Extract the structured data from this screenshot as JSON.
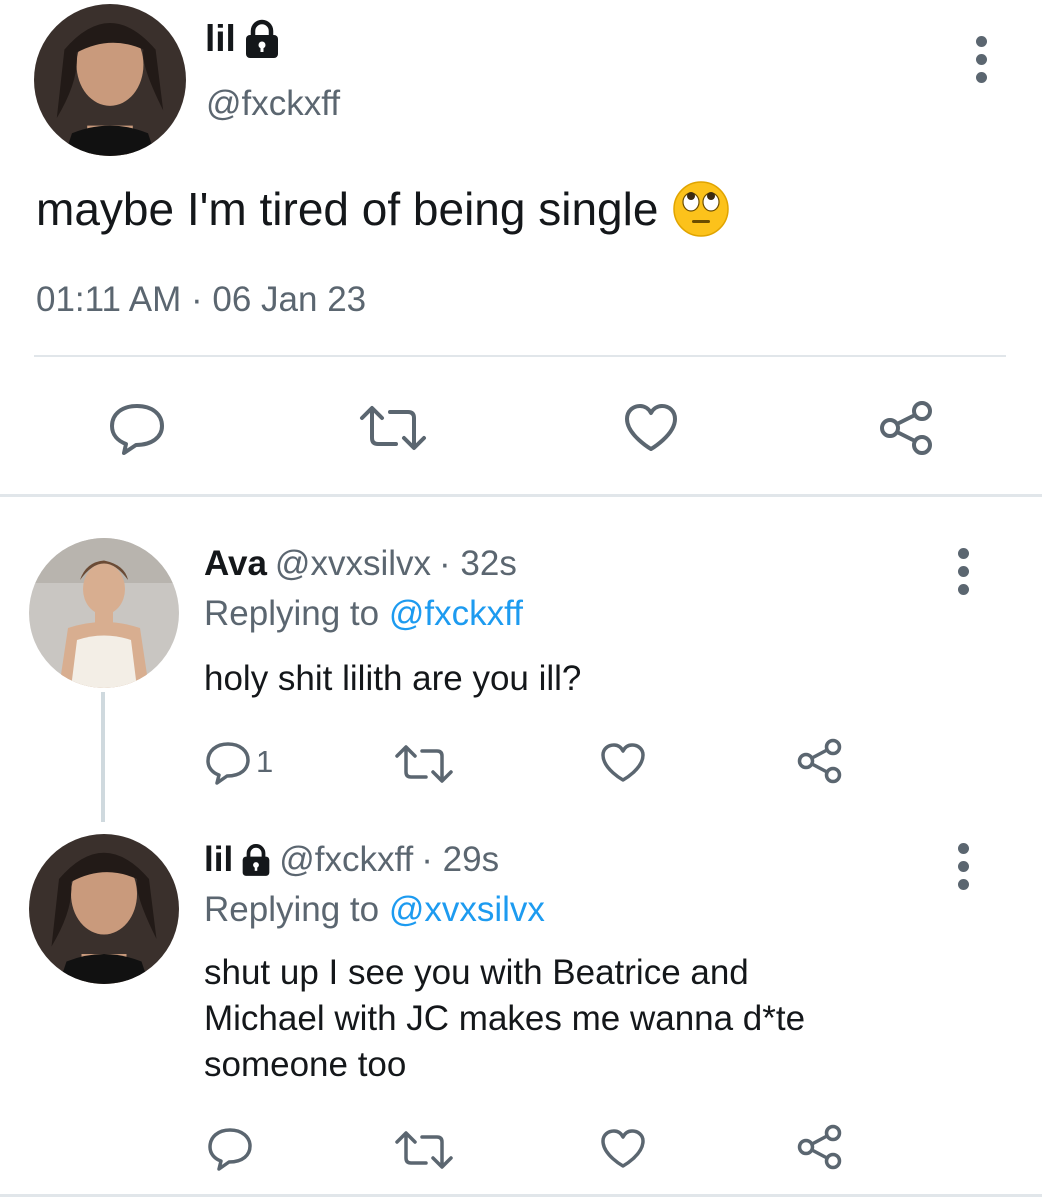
{
  "main_tweet": {
    "name": "lil",
    "handle": "@fxckxff",
    "text": "maybe I'm tired of being single",
    "timestamp": "01:11 AM · 06 Jan 23"
  },
  "replies": [
    {
      "name": "Ava",
      "handle": "@xvxsilvx",
      "time": "· 32s",
      "replying_prefix": "Replying to",
      "replying_to": "@fxckxff",
      "text": "holy shit lilith are you ill?",
      "reply_count": "1"
    },
    {
      "name": "lil",
      "handle": "@fxckxff",
      "time": "· 29s",
      "replying_prefix": "Replying to",
      "replying_to": "@xvxsilvx",
      "text_lines": [
        "shut up I see you with Beatrice and",
        "Michael with JC makes me wanna d*te",
        "someone too"
      ]
    }
  ],
  "colors": {
    "icon_gray": "#5b6670",
    "mention_blue": "#1d9bf0",
    "divider": "#e1e6ea"
  },
  "icons": [
    "lock-icon",
    "more-icon",
    "reply-icon",
    "retweet-icon",
    "like-icon",
    "share-icon",
    "eye-roll-emoji"
  ]
}
